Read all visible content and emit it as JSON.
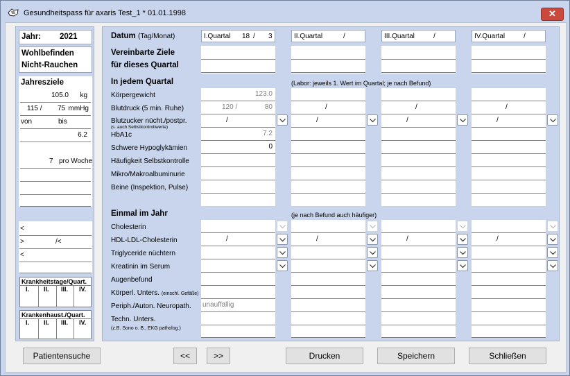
{
  "window": {
    "title": "Gesundheitspass für axaris Test_1   * 01.01.1998",
    "close": "✕"
  },
  "left": {
    "jahr_label": "Jahr:",
    "jahr_value": "2021",
    "wohlbefinden": "Wohlbefinden",
    "nichtrauchen": "Nicht-Rauchen",
    "jahresziele": "Jahresziele",
    "gewicht_value": "105.0",
    "gewicht_unit": "kg",
    "bd_sys": "115 /",
    "bd_dia": "75",
    "bd_unit": "mmHg",
    "bz_von": "von",
    "bz_bis": "bis",
    "hba1c": "6.2",
    "selbstkontrolle": "7",
    "selbstkontrolle_unit": "pro Woche",
    "chol": "<",
    "hdl_a": ">",
    "hdl_b": "/<",
    "trig": "<",
    "krankheitstage": "Krankheitstage/Quart.",
    "krankenhaus": "Krankenhaust./Quart.",
    "quarters": [
      "I.",
      "II.",
      "III.",
      "IV."
    ]
  },
  "labels": {
    "datum": "Datum",
    "datum_sub": "(Tag/Monat)",
    "ziele1": "Vereinbarte Ziele",
    "ziele2": "für dieses Quartal",
    "jedem": "In jedem Quartal",
    "jedem_note": "(Labor: jeweils 1. Wert im Quartal; je nach Befund)",
    "koerpergewicht": "Körpergewicht",
    "blutdruck": "Blutdruck (5 min. Ruhe)",
    "blutzucker": "Blutzucker nücht./postpr.",
    "blutzucker_sub": "(s. auch Selbstkontrollwerte)",
    "hba1c": "HbA1c",
    "hypo": "Schwere Hypoglykämien",
    "haeufigkeit": "Häufigkeit Selbstkontrolle",
    "mikro": "Mikro/Makroalbuminurie",
    "beine": "Beine (Inspektion, Pulse)",
    "einmal": "Einmal im Jahr",
    "einmal_note": "(je nach Befund auch häufiger)",
    "cholesterin": "Cholesterin",
    "hdl": "HDL-LDL-Cholesterin",
    "trig": "Triglyceride nüchtern",
    "kreatinin": "Kreatinin im Serum",
    "augen": "Augenbefund",
    "koerperl": "Körperl. Unters.",
    "koerperl_sub": "(einschl. Gefäße)",
    "periph": "Periph./Auton. Neuropath.",
    "techn": "Techn. Unters.",
    "techn_sub": "(z.B. Sono o. B., EKG patholog.)"
  },
  "quarters": [
    {
      "name": "I.Quartal",
      "day": "18",
      "sep": "/",
      "month": "3",
      "gewicht": "123.0",
      "bd_sys": "120 /",
      "bd_dia": "80",
      "bz": "/",
      "hba1c": "7.2",
      "hypo": "0",
      "hdl": "/",
      "periph": "unauffällig"
    },
    {
      "name": "II.Quartal",
      "day": "",
      "sep": "/",
      "month": "",
      "gewicht": "",
      "bd_sys": "/",
      "bd_dia": "",
      "bz": "/",
      "hba1c": "",
      "hypo": "",
      "hdl": "/",
      "periph": ""
    },
    {
      "name": "III.Quartal",
      "day": "",
      "sep": "/",
      "month": "",
      "gewicht": "",
      "bd_sys": "/",
      "bd_dia": "",
      "bz": "/",
      "hba1c": "",
      "hypo": "",
      "hdl": "/",
      "periph": ""
    },
    {
      "name": "IV.Quartal",
      "day": "",
      "sep": "/",
      "month": "",
      "gewicht": "",
      "bd_sys": "/",
      "bd_dia": "",
      "bz": "/",
      "hba1c": "",
      "hypo": "",
      "hdl": "/",
      "periph": ""
    }
  ],
  "buttons": {
    "patientensuche": "Patientensuche",
    "prev": "<<",
    "next": ">>",
    "drucken": "Drucken",
    "speichern": "Speichern",
    "schliessen": "Schließen"
  }
}
